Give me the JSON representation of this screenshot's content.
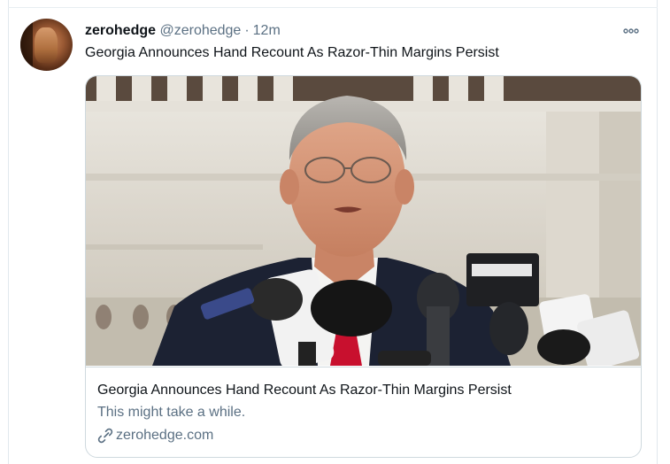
{
  "tweet": {
    "author_name": "zerohedge",
    "author_handle": "@zerohedge",
    "separator": "·",
    "timestamp": "12m",
    "more_icon": "more-horizontal-icon",
    "text": "Georgia Announces Hand Recount As Razor-Thin Margins Persist"
  },
  "card": {
    "image_icon": "press-conference-photo",
    "title": "Georgia Announces Hand Recount As Razor-Thin Margins Persist",
    "description": "This might take a while.",
    "domain_icon": "link-icon",
    "domain": "zerohedge.com"
  },
  "colors": {
    "text_primary": "#0f1419",
    "text_secondary": "#5b7083",
    "border": "#cfd9de",
    "tie_red": "#c8102e"
  }
}
